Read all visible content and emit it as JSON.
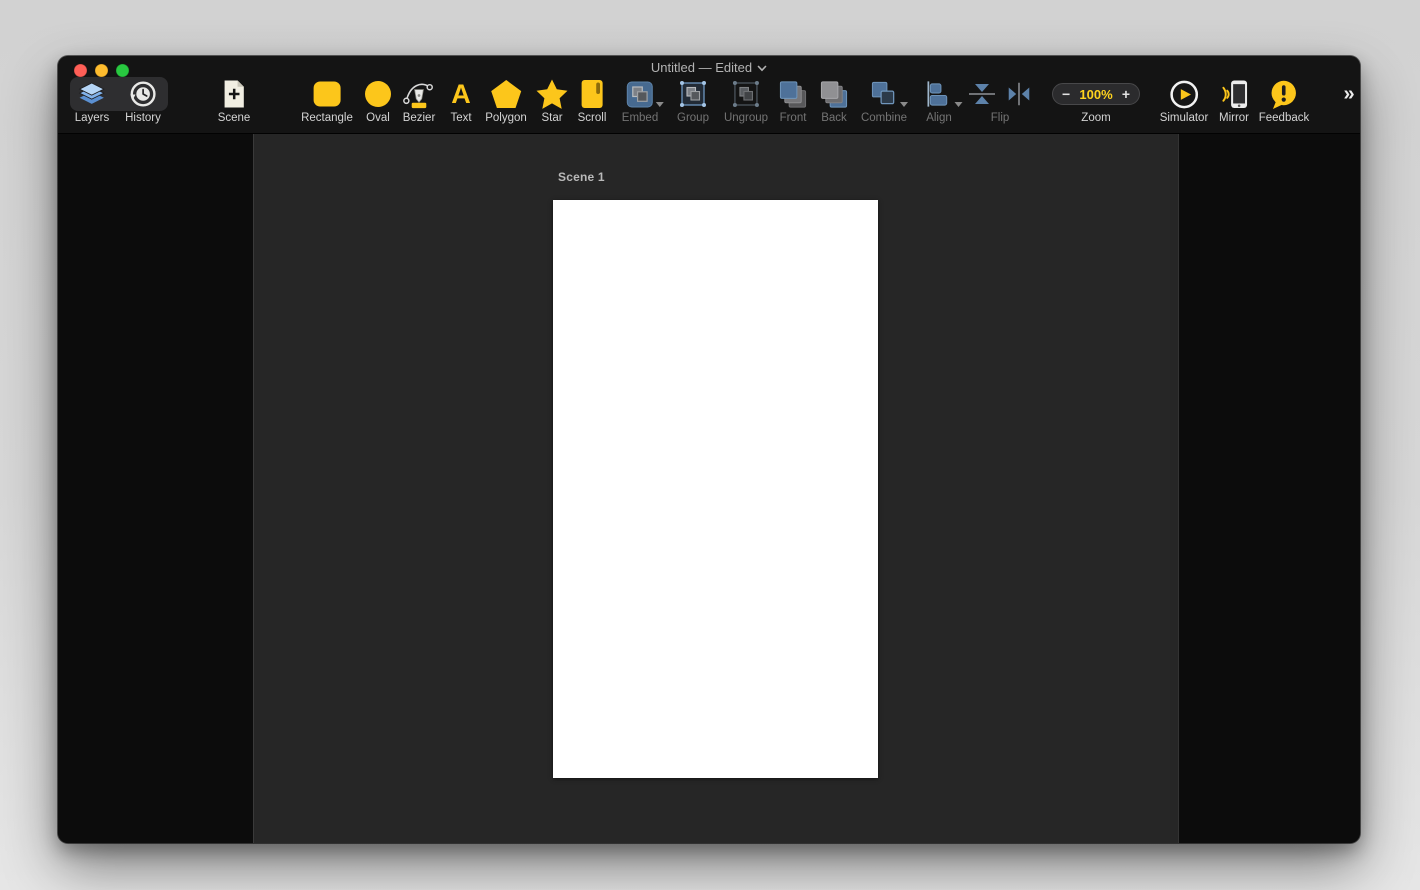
{
  "window": {
    "title": "Untitled — Edited"
  },
  "panel_switcher": {
    "layers": "Layers",
    "history": "History"
  },
  "toolbar": {
    "labels": {
      "scene": "Scene",
      "rectangle": "Rectangle",
      "oval": "Oval",
      "bezier": "Bezier",
      "text": "Text",
      "polygon": "Polygon",
      "star": "Star",
      "scroll": "Scroll",
      "embed": "Embed",
      "group": "Group",
      "ungroup": "Ungroup",
      "front": "Front",
      "back": "Back",
      "combine": "Combine",
      "align": "Align",
      "flip": "Flip",
      "zoom": "Zoom",
      "simulator": "Simulator",
      "mirror": "Mirror",
      "feedback": "Feedback"
    },
    "text_glyph": "A",
    "zoom_control": {
      "decrease": "−",
      "value": "100%",
      "increase": "+"
    },
    "overflow": "»"
  },
  "canvas": {
    "scene_name": "Scene 1"
  },
  "colors": {
    "accent_gold": "#FCC61B",
    "steel_blue": "#4E7199",
    "layers_blue": "#7FB0E8",
    "zoom_value": "#FFD41E",
    "traffic_red": "#FF5F57",
    "traffic_yellow": "#FEBC2E",
    "traffic_green": "#28C840",
    "canvas_bg": "#262626",
    "panel_bg": "#0C0C0C",
    "chrome_bg": "#141414"
  }
}
